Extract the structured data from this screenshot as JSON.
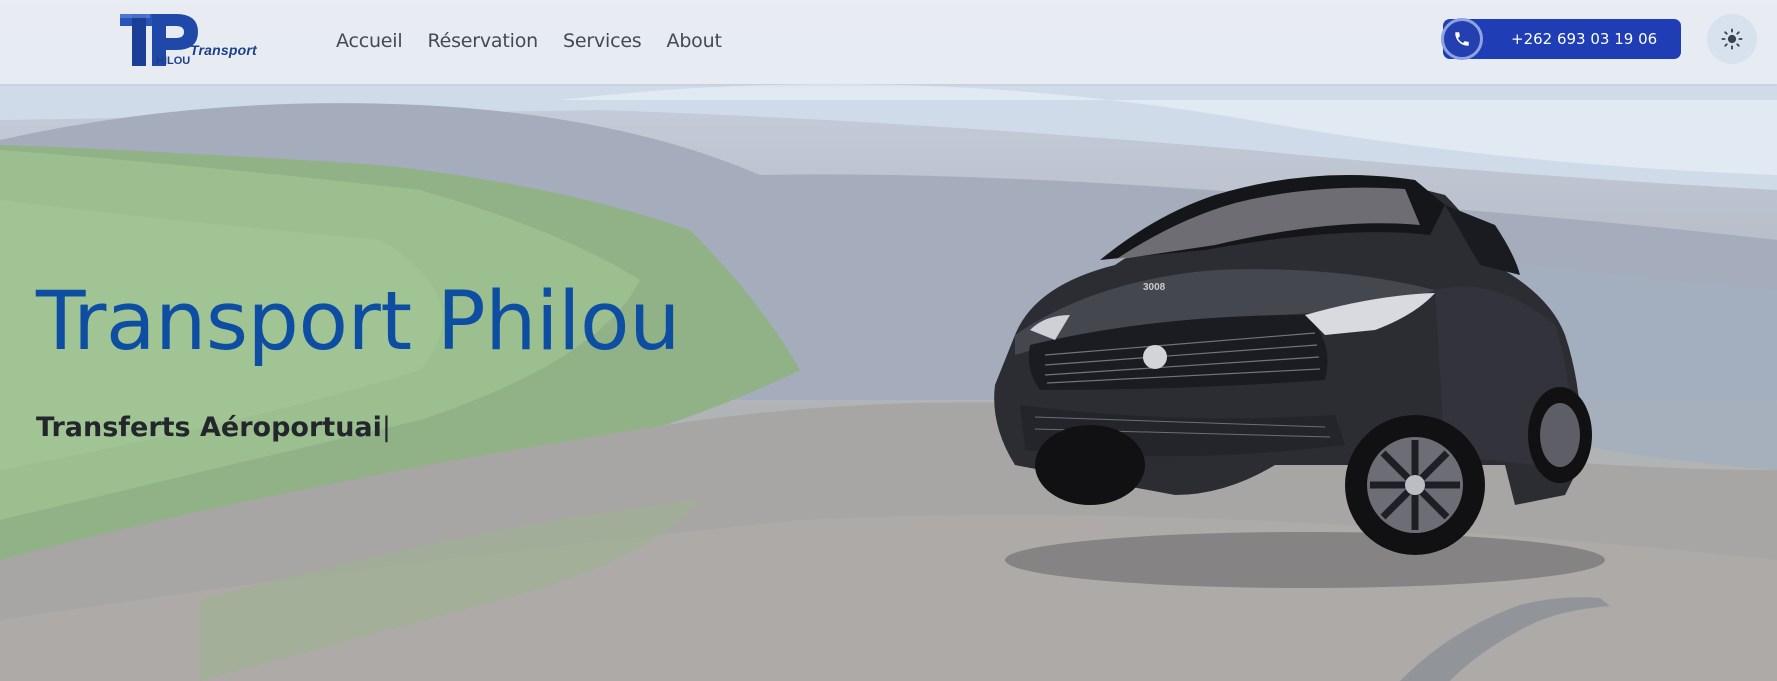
{
  "header": {
    "logo": {
      "text": "Transport",
      "sub": "HILOU"
    },
    "nav": [
      {
        "label": "Accueil"
      },
      {
        "label": "Réservation"
      },
      {
        "label": "Services"
      },
      {
        "label": "About"
      }
    ],
    "phone": {
      "number": "+262 693 03 19 06",
      "icon": "phone-icon"
    },
    "theme_toggle": {
      "icon": "sun-icon"
    }
  },
  "hero": {
    "title": "Transport Philou",
    "subtitle": "Transferts Aéroportuai",
    "caret": "|",
    "car_badge": "3008"
  },
  "colors": {
    "title": "#0d4ea2",
    "phone_button": "#1f3db5",
    "nav_text": "#444a55"
  }
}
